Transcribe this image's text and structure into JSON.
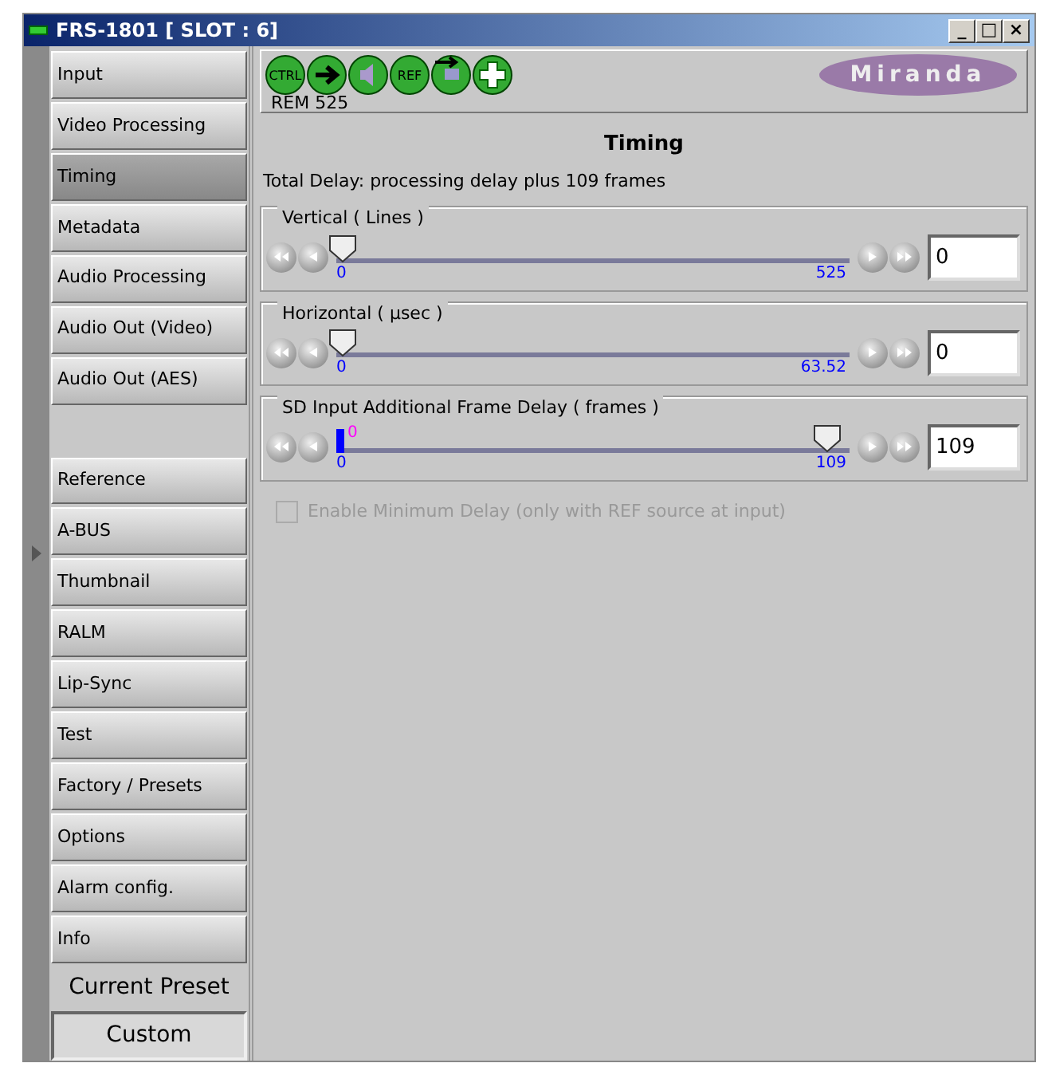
{
  "window": {
    "title": "FRS-1801 [ SLOT : 6]",
    "controls": [
      "_",
      "□",
      "×"
    ]
  },
  "sidebar": {
    "top_items": [
      {
        "label": "Input",
        "selected": false
      },
      {
        "label": "Video Processing",
        "selected": false
      },
      {
        "label": "Timing",
        "selected": true
      },
      {
        "label": "Metadata",
        "selected": false
      },
      {
        "label": "Audio Processing",
        "selected": false
      },
      {
        "label": "Audio Out (Video)",
        "selected": false
      },
      {
        "label": "Audio Out (AES)",
        "selected": false
      }
    ],
    "bottom_items": [
      {
        "label": "Reference",
        "selected": false
      },
      {
        "label": "A-BUS",
        "selected": false
      },
      {
        "label": "Thumbnail",
        "selected": false
      },
      {
        "label": "RALM",
        "selected": false
      },
      {
        "label": "Lip-Sync",
        "selected": false
      },
      {
        "label": "Test",
        "selected": false
      },
      {
        "label": "Factory / Presets",
        "selected": false
      },
      {
        "label": "Options",
        "selected": false
      },
      {
        "label": "Alarm config.",
        "selected": false
      },
      {
        "label": "Info",
        "selected": false
      }
    ],
    "preset_label": "Current Preset",
    "preset_value": "Custom"
  },
  "toolbar": {
    "icons": [
      {
        "kind": "text",
        "label": "CTRL"
      },
      {
        "kind": "arrow"
      },
      {
        "kind": "speaker"
      },
      {
        "kind": "text",
        "label": "REF"
      },
      {
        "kind": "swap"
      },
      {
        "kind": "plus"
      }
    ],
    "status": "REM 525",
    "logo": "Miranda"
  },
  "panel": {
    "title": "Timing",
    "summary": "Total Delay: processing delay  plus 109 frames",
    "sliders": [
      {
        "label": "Vertical ( Lines )",
        "level": 0,
        "min_label": "0",
        "max_label": "525",
        "value": "0"
      },
      {
        "label": "Horizontal ( µsec )",
        "level": 0,
        "min_label": "0",
        "max_label": "63.52",
        "value": "0"
      },
      {
        "label": "SD Input Additional Frame Delay ( frames )",
        "level": 1,
        "min_label": "0",
        "max_label": "109",
        "value": "109",
        "marker_label": "0"
      }
    ],
    "checkbox": {
      "label": "Enable Minimum Delay (only with REF source at input)",
      "checked": false,
      "disabled": true
    }
  }
}
